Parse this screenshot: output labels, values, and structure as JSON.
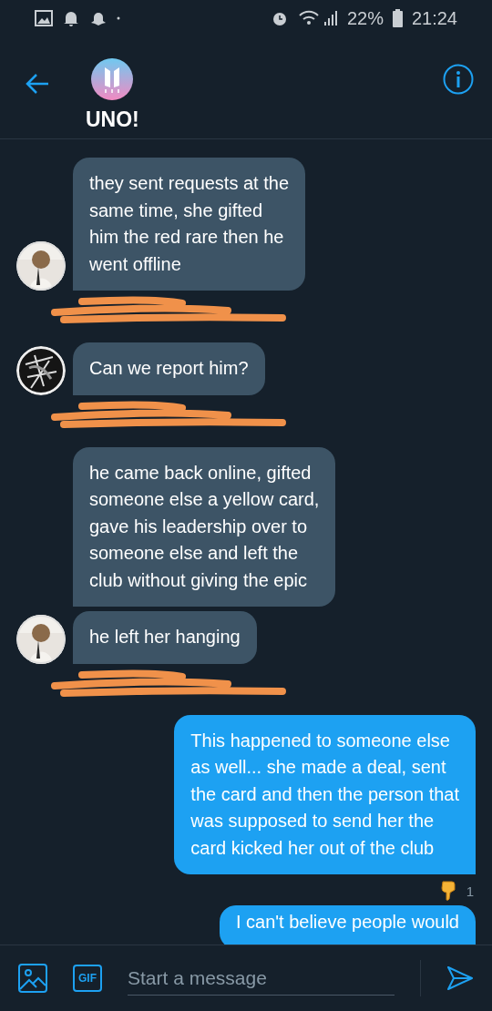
{
  "status_bar": {
    "battery": "22%",
    "time": "21:24"
  },
  "header": {
    "title": "UNO!"
  },
  "messages": [
    {
      "kind": "received",
      "avatar": {
        "kind": "portrait"
      },
      "text": "they sent requests at the\nsame time, she gifted\nhim the red rare then he\nwent offline",
      "scribble": true
    },
    {
      "kind": "received",
      "avatar": {
        "kind": "sketch"
      },
      "text": "Can we report him?",
      "scribble": true
    },
    {
      "kind": "received",
      "text": "he came back online, gifted\nsomeone else a yellow card,\ngave his leadership over to\nsomeone else and left the\nclub without giving the epic",
      "scribble": false
    },
    {
      "kind": "received",
      "avatar": {
        "kind": "portrait"
      },
      "text": "he left her hanging",
      "scribble": true
    },
    {
      "kind": "sent",
      "text": "This happened to someone else\nas well... she made a deal, sent\nthe card and then the person that\nwas supposed to send her the\ncard kicked her out of the club",
      "reaction": {
        "count": "1"
      }
    },
    {
      "kind": "sent",
      "text": "I can't believe people would"
    }
  ],
  "composer": {
    "gif_label": "GIF",
    "placeholder": "Start a message"
  }
}
